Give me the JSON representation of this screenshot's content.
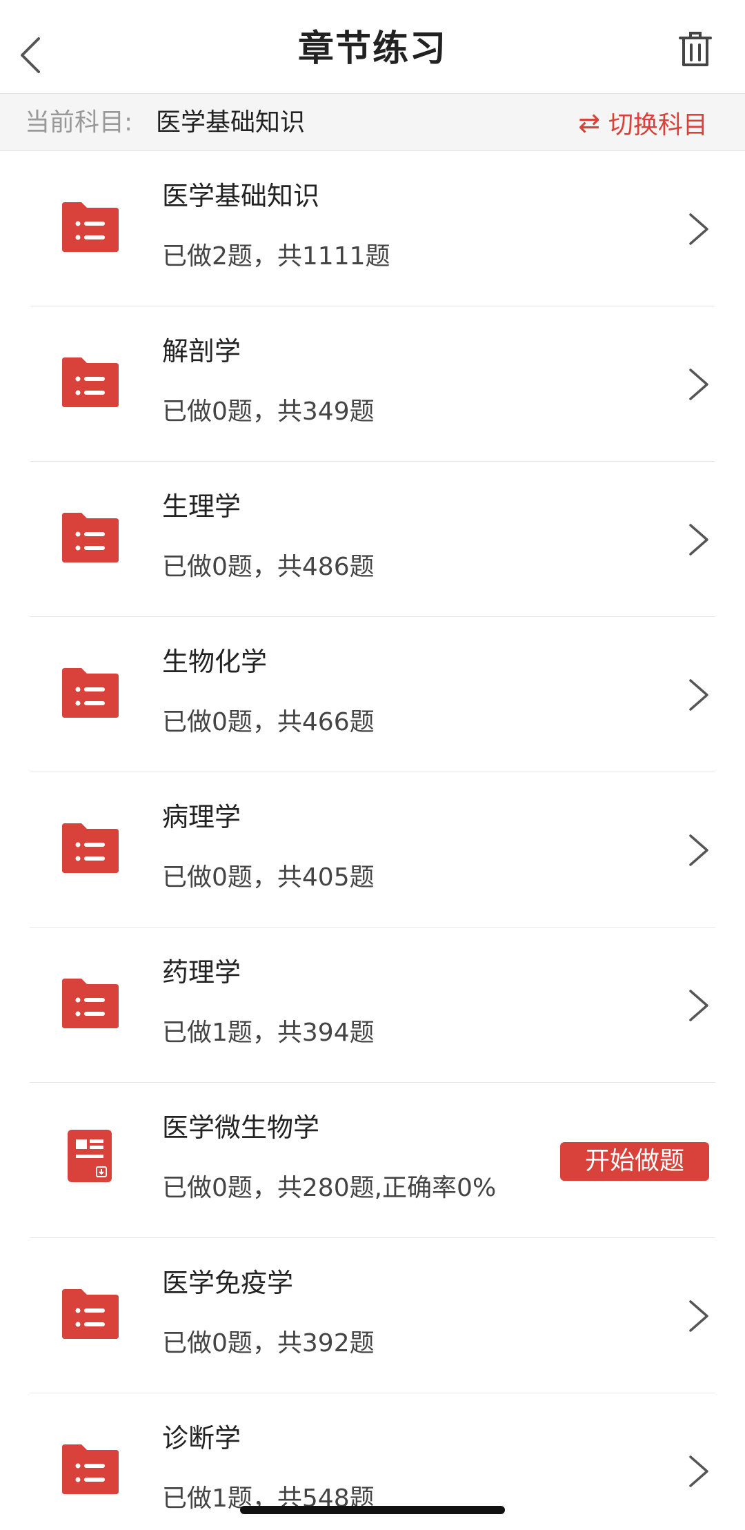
{
  "header": {
    "title": "章节练习",
    "back_icon": "chevron-left-icon",
    "trash_icon": "trash-icon"
  },
  "subject_bar": {
    "label": "当前科目:",
    "current": "医学基础知识",
    "switch_icon": "⇄",
    "switch_label": "切换科目"
  },
  "colors": {
    "accent": "#d9423a",
    "text": "#222222",
    "muted": "#999999",
    "divider": "#e6e6e6",
    "subject_bg": "#f5f5f5"
  },
  "chapters": [
    {
      "title": "医学基础知识",
      "progress": "已做2题，共1111题",
      "icon": "folder-list-icon",
      "action": "chevron"
    },
    {
      "title": "解剖学",
      "progress": "已做0题，共349题",
      "icon": "folder-list-icon",
      "action": "chevron"
    },
    {
      "title": "生理学",
      "progress": "已做0题，共486题",
      "icon": "folder-list-icon",
      "action": "chevron"
    },
    {
      "title": "生物化学",
      "progress": "已做0题，共466题",
      "icon": "folder-list-icon",
      "action": "chevron"
    },
    {
      "title": "病理学",
      "progress": "已做0题，共405题",
      "icon": "folder-list-icon",
      "action": "chevron"
    },
    {
      "title": "药理学",
      "progress": "已做1题，共394题",
      "icon": "folder-list-icon",
      "action": "chevron"
    },
    {
      "title": "医学微生物学",
      "progress": "已做0题，共280题,正确率0%",
      "icon": "paper-icon",
      "action": "button",
      "button_label": "开始做题"
    },
    {
      "title": "医学免疫学",
      "progress": "已做0题，共392题",
      "icon": "folder-list-icon",
      "action": "chevron"
    },
    {
      "title": "诊断学",
      "progress": "已做1题，共548题",
      "icon": "folder-list-icon",
      "action": "chevron"
    }
  ]
}
